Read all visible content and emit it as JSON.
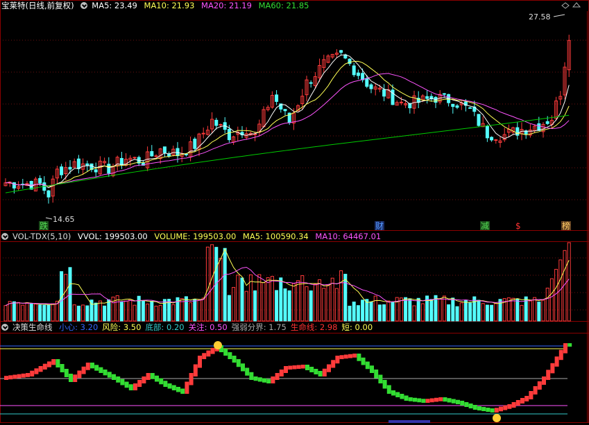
{
  "colors": {
    "bg": "#000000",
    "frame": "#8b0000",
    "up": "#ff3b3b",
    "down": "#54ffff",
    "ma5": "#ffffff",
    "ma10": "#ffff55",
    "ma20": "#ff55ff",
    "ma60": "#00cc00",
    "grid": "#6b1010"
  },
  "main": {
    "stock_name": "宝莱特",
    "period_label": "(日线,前复权)",
    "ma5_text": "MA5: 23.49",
    "ma10_text": "MA10: 21.93",
    "ma20_text": "MA20: 21.19",
    "ma60_text": "MA60: 21.85",
    "high_label": "27.58",
    "low_label": "14.65",
    "signals": [
      {
        "text": "跌",
        "color": "#55dd55",
        "bg": "#1a4d1a"
      },
      {
        "text": "财",
        "color": "#5599ff",
        "bg": "#1a2d66"
      },
      {
        "text": "减",
        "color": "#55dd55",
        "bg": "#1a4d1a"
      },
      {
        "text": "$",
        "color": "#ff3333",
        "bg": "#000000"
      },
      {
        "text": "榜",
        "color": "#ffcc66",
        "bg": "#664422"
      }
    ]
  },
  "volume": {
    "indicator_name": "VOL-TDX(5,10)",
    "vvol_text": "VVOL: 199503.00",
    "volume_text": "VOLUME: 199503.00",
    "ma5_text": "MA5: 100590.34",
    "ma10_text": "MA10: 64467.01"
  },
  "lower": {
    "indicator_name": "决策生命线",
    "items": [
      {
        "label": "小心:",
        "value": "3.20",
        "color": "#3366ff"
      },
      {
        "label": "风险:",
        "value": "3.50",
        "color": "#ffff55"
      },
      {
        "label": "底部:",
        "value": "0.20",
        "color": "#33cccc"
      },
      {
        "label": "关注:",
        "value": "0.50",
        "color": "#ff55ff"
      },
      {
        "label": "强弱分界:",
        "value": "1.75",
        "color": "#aaaaaa"
      },
      {
        "label": "生命线:",
        "value": "2.98",
        "color": "#ff3333"
      },
      {
        "label": "短:",
        "value": "0.00",
        "color": "#ffff55"
      }
    ]
  }
}
